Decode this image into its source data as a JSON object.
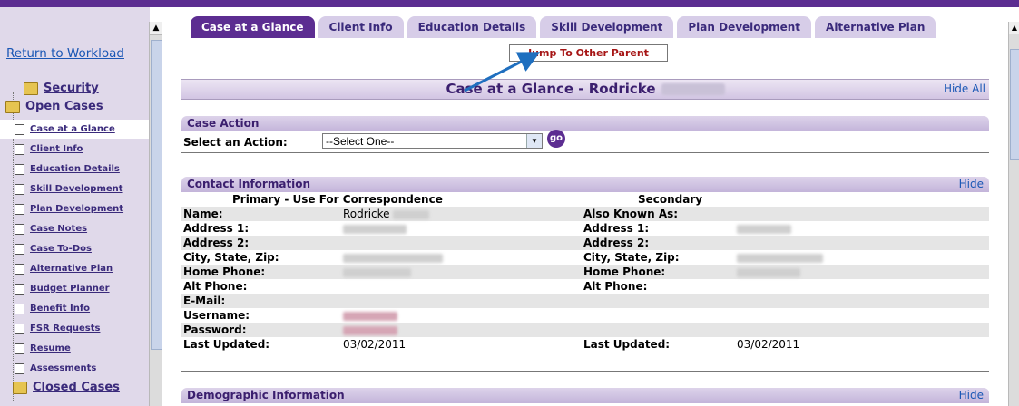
{
  "sidebar": {
    "return_link": "Return to Workload",
    "security": "Security",
    "open_cases": "Open Cases",
    "items": [
      {
        "label": "Case at a Glance",
        "selected": true
      },
      {
        "label": "Client Info"
      },
      {
        "label": "Education Details"
      },
      {
        "label": "Skill Development"
      },
      {
        "label": "Plan Development"
      },
      {
        "label": "Case Notes"
      },
      {
        "label": "Case To-Dos"
      },
      {
        "label": "Alternative Plan"
      },
      {
        "label": "Budget Planner"
      },
      {
        "label": "Benefit Info"
      },
      {
        "label": "FSR Requests"
      },
      {
        "label": "Resume"
      },
      {
        "label": "Assessments"
      }
    ],
    "closed_cases": "Closed Cases"
  },
  "tabs": [
    {
      "label": "Case at a Glance",
      "active": true
    },
    {
      "label": "Client Info"
    },
    {
      "label": "Education Details"
    },
    {
      "label": "Skill Development"
    },
    {
      "label": "Plan Development"
    },
    {
      "label": "Alternative Plan"
    }
  ],
  "jump_button": "Jump To Other Parent",
  "page_title": "Case at a Glance - Rodricke",
  "hide_all": "Hide All",
  "case_action": {
    "header": "Case Action",
    "label": "Select an Action:",
    "select_value": "--Select One--",
    "go": "go"
  },
  "contact": {
    "header": "Contact Information",
    "hide": "Hide",
    "primary_header": "Primary - Use For Correspondence",
    "secondary_header": "Secondary",
    "rows": [
      {
        "l1": "Name:",
        "v1": "Rodricke",
        "l2": "Also Known As:",
        "v2": ""
      },
      {
        "l1": "Address 1:",
        "v1": "",
        "l2": "Address 1:",
        "v2": ""
      },
      {
        "l1": "Address 2:",
        "v1": "",
        "l2": "Address 2:",
        "v2": ""
      },
      {
        "l1": "City, State, Zip:",
        "v1": "",
        "l2": "City, State, Zip:",
        "v2": ""
      },
      {
        "l1": "Home Phone:",
        "v1": "",
        "l2": "Home Phone:",
        "v2": ""
      },
      {
        "l1": "Alt Phone:",
        "v1": "",
        "l2": "Alt Phone:",
        "v2": ""
      },
      {
        "l1": "E-Mail:",
        "v1": "",
        "l2": "",
        "v2": ""
      },
      {
        "l1": "Username:",
        "v1": "",
        "l2": "",
        "v2": ""
      },
      {
        "l1": "Password:",
        "v1": "",
        "l2": "",
        "v2": ""
      },
      {
        "l1": "Last Updated:",
        "v1": "03/02/2011",
        "l2": "Last Updated:",
        "v2": "03/02/2011"
      }
    ]
  },
  "demographic": {
    "header": "Demographic Information",
    "hide": "Hide"
  },
  "colors": {
    "brand": "#5c2d91",
    "link": "#1a57b5",
    "annotation_arrow": "#1f6fbf"
  }
}
